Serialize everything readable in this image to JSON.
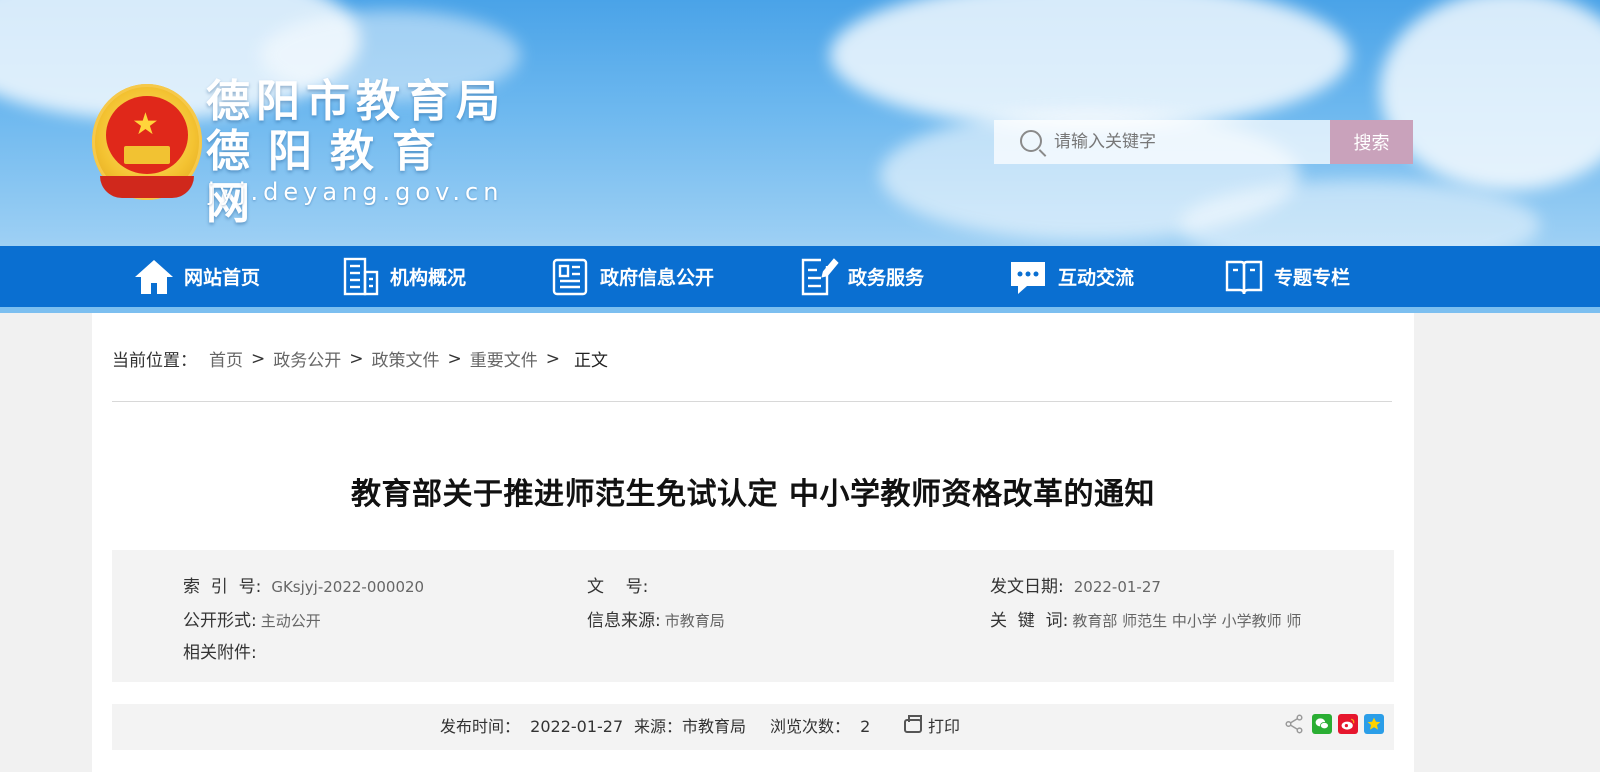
{
  "header": {
    "site_name": "德阳市教育局",
    "site_name_2": "德阳教育网",
    "domain": "jyj.deyang.gov.cn",
    "search": {
      "placeholder": "请输入关键字",
      "button_label": "搜索"
    }
  },
  "nav": {
    "items": [
      {
        "label": "网站首页",
        "icon": "home-icon"
      },
      {
        "label": "机构概况",
        "icon": "building-icon"
      },
      {
        "label": "政府信息公开",
        "icon": "newspaper-icon"
      },
      {
        "label": "政务服务",
        "icon": "edit-document-icon"
      },
      {
        "label": "互动交流",
        "icon": "chat-icon"
      },
      {
        "label": "专题专栏",
        "icon": "book-icon"
      }
    ]
  },
  "breadcrumb": {
    "prefix": "当前位置：",
    "links": [
      "首页",
      "政务公开",
      "政策文件",
      "重要文件"
    ],
    "separator": ">",
    "current": "正文"
  },
  "article": {
    "title": "教育部关于推进师范生免试认定 中小学教师资格改革的通知",
    "meta": {
      "index_label": "索  引  号:",
      "index_value": "GKsjyj-2022-000020",
      "doc_no_label": "文    号:",
      "doc_no_value": "",
      "issue_date_label": "发文日期:",
      "issue_date_value": "2022-01-27",
      "public_form_label": "公开形式:",
      "public_form_value": "主动公开",
      "info_source_label": "信息来源:",
      "info_source_value": "市教育局",
      "keywords_label": "关  键  词:",
      "keywords_value": "教育部 师范生 中小学 小学教师 师",
      "attachments_label": "相关附件:"
    },
    "info_bar": {
      "publish_time": "发布时间：  2022-01-27",
      "source": "来源：市教育局",
      "views": "浏览次数：  2",
      "print_label": "打印"
    }
  }
}
